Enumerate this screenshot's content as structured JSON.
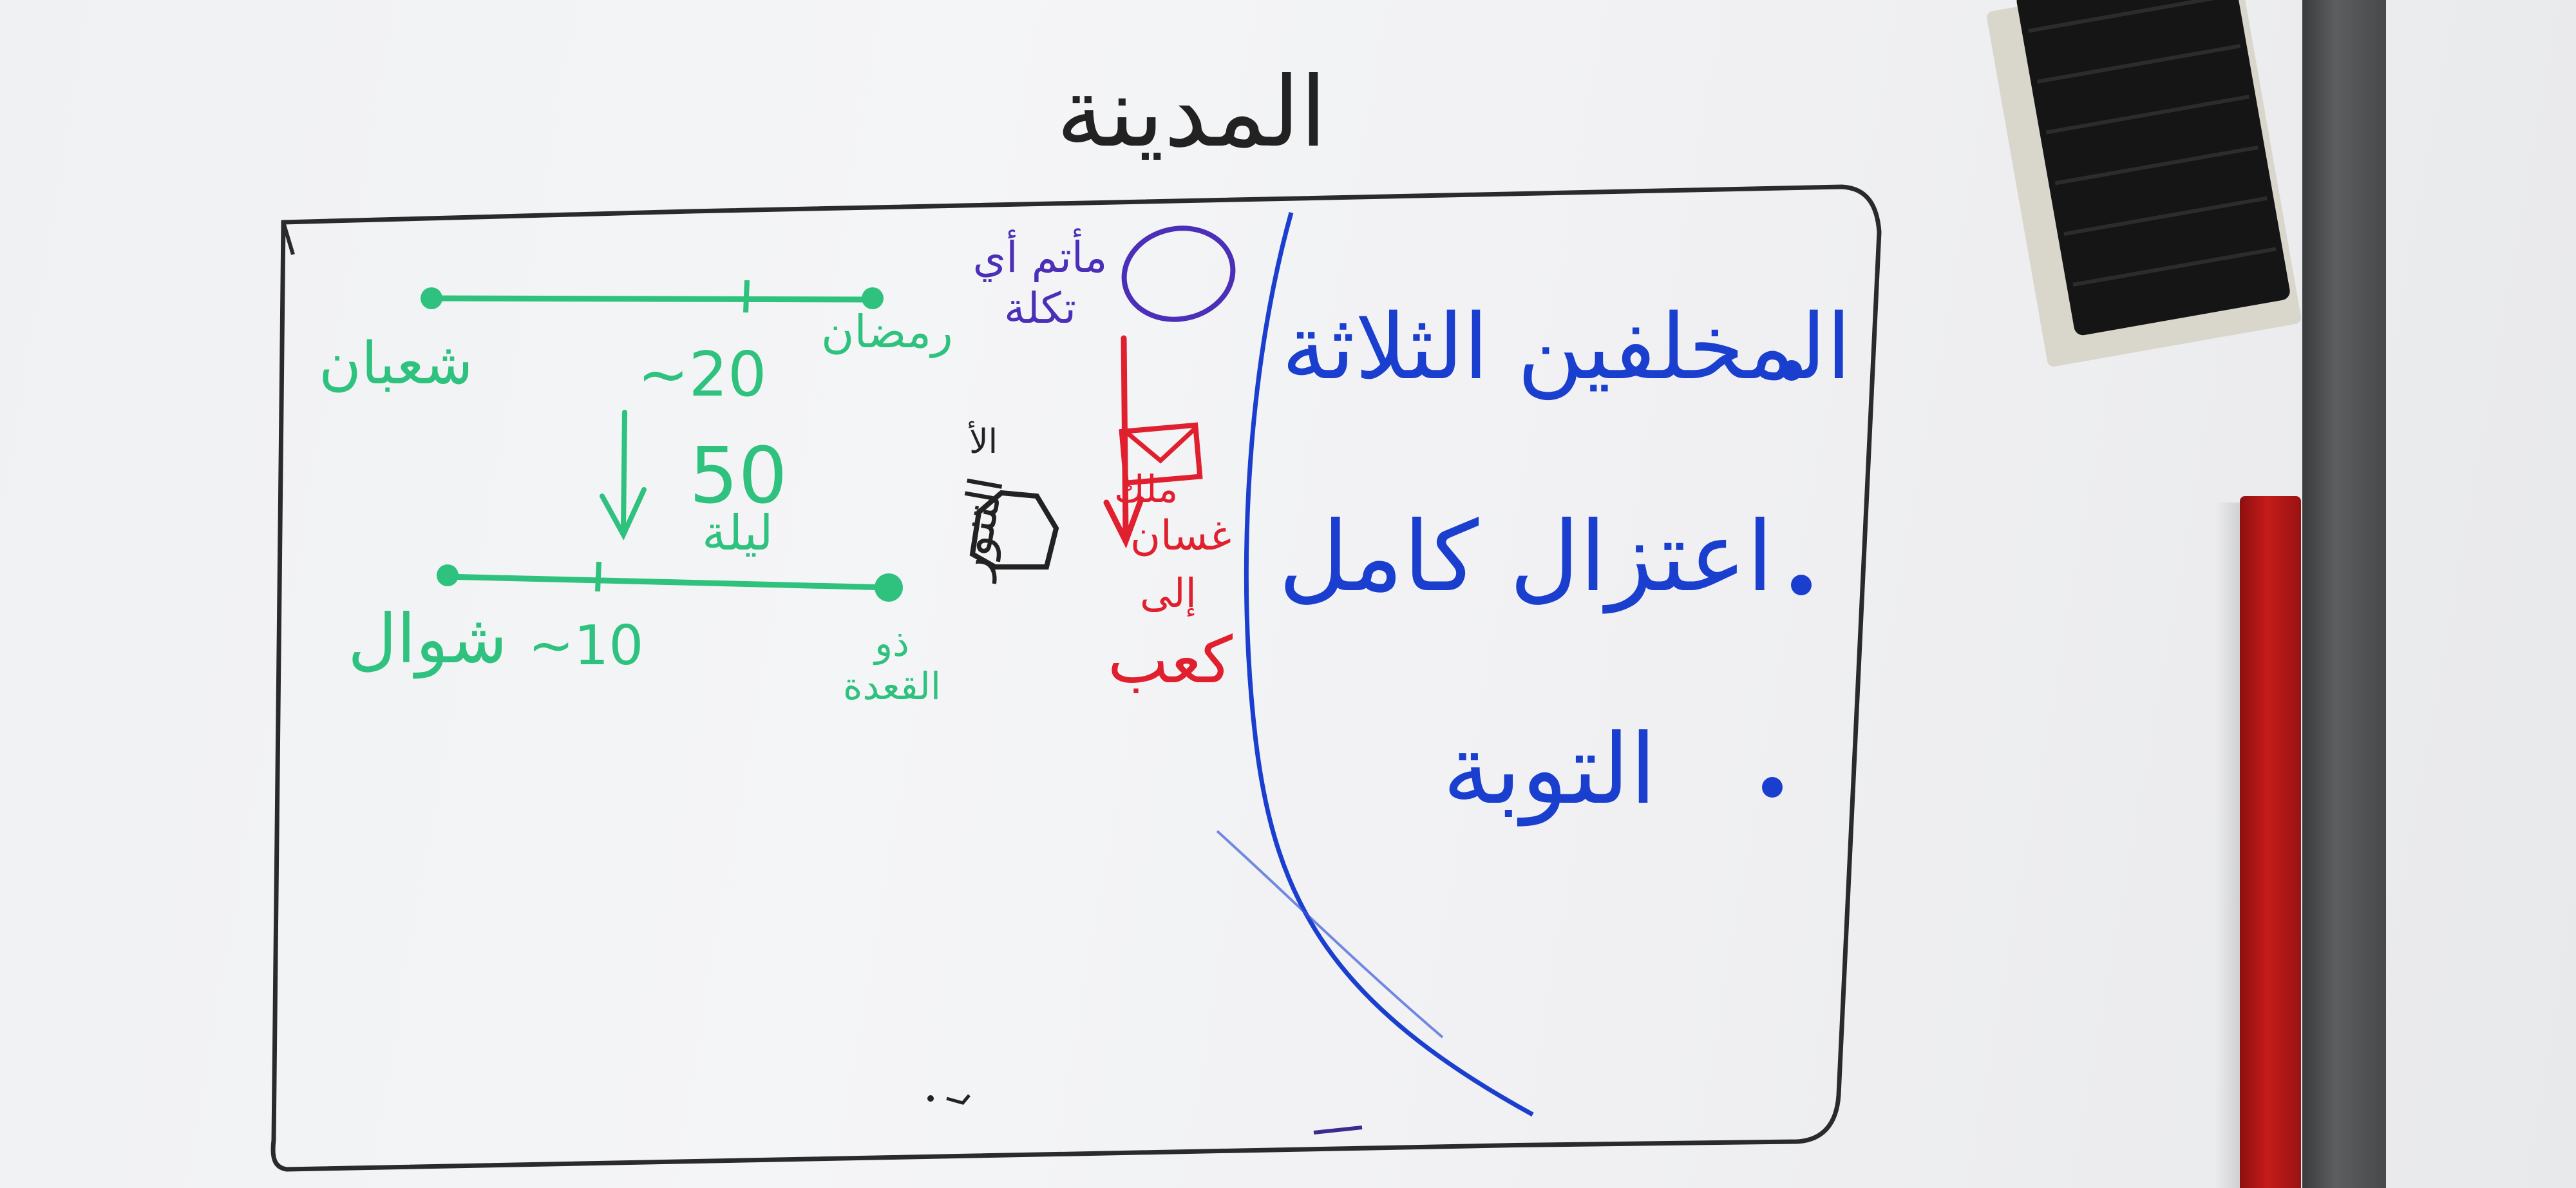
{
  "board": {
    "title": "المدينة",
    "right_list": [
      "المخلفين الثلاثة",
      "اعتزال كامل",
      "التوبة"
    ],
    "timeline_top": {
      "start": "شعبان",
      "end": "رمضان",
      "marker": "~20"
    },
    "timeline_bottom": {
      "start": "شوال",
      "end": "ذو القعدة",
      "marker": "~10"
    },
    "duration_value": "50",
    "duration_unit": "ليلة",
    "purple_note": "مأتم أي تكلة",
    "red_note_1": "ملك",
    "red_note_2": "غسان",
    "red_note_3": "إلى",
    "red_note_4": "كعب",
    "black_note_1": "الأ",
    "black_note_2": "التنور"
  },
  "ink_colors": {
    "black": "#222222",
    "blue": "#1a3fcf",
    "green": "#2ec27e",
    "red": "#e0202e",
    "purple": "#4b2fb8",
    "eraser": "#151515",
    "tray": "#4a4c4e",
    "marker_red": "#b51a1a"
  }
}
